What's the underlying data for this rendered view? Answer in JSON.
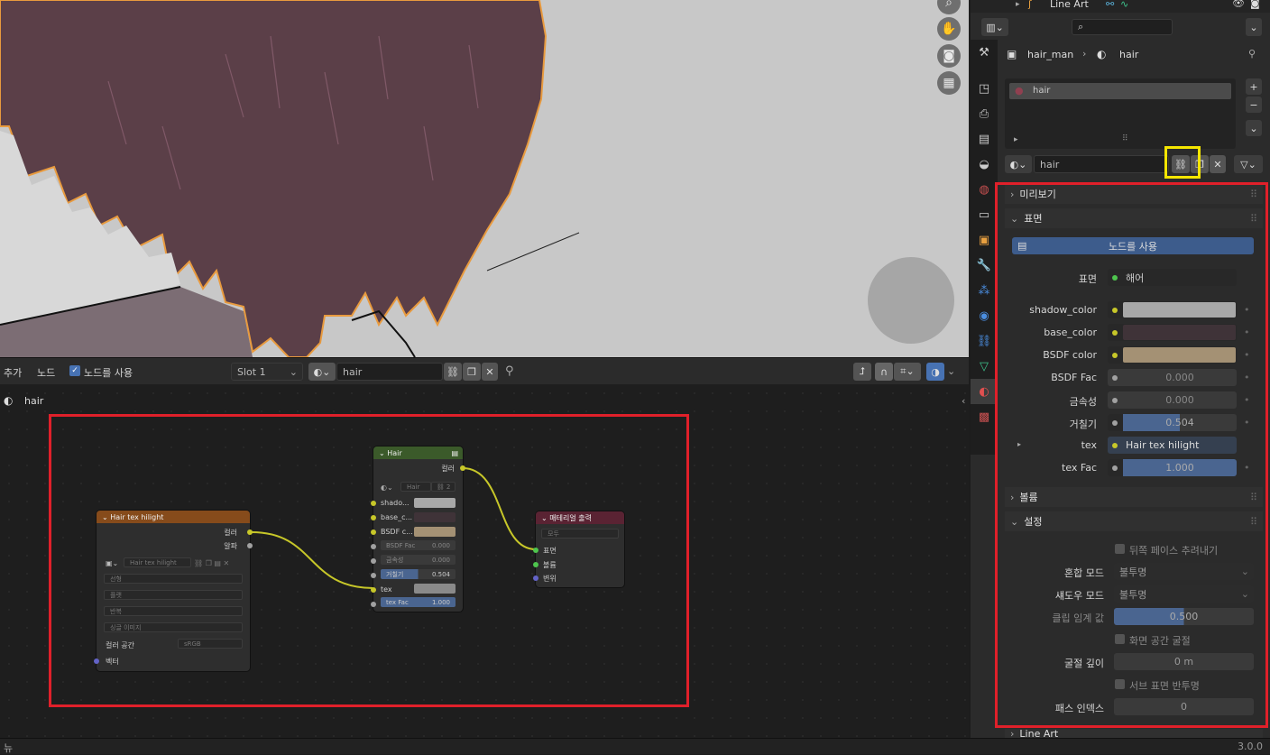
{
  "outliner": {
    "item": "Line Art"
  },
  "properties": {
    "breadcrumb_object": "hair_man",
    "breadcrumb_material": "hair",
    "slot_item": "hair",
    "material_name": "hair",
    "add_label": "+",
    "remove_label": "−",
    "panels": {
      "preview": "미리보기",
      "surface": "표면",
      "volume": "볼륨",
      "settings": "설정",
      "lineart": "Line Art"
    },
    "use_nodes_button": "노드를 사용",
    "surface_label": "표면",
    "surface_value": "해어",
    "inputs": [
      {
        "label": "shadow_color",
        "value": "",
        "color": "#a8a8a8"
      },
      {
        "label": "base_color",
        "value": "",
        "color": "#3f3338"
      },
      {
        "label": "BSDF color",
        "value": "",
        "color": "#a49174"
      },
      {
        "label": "BSDF Fac",
        "value": "0.000"
      },
      {
        "label": "금속성",
        "value": "0.000"
      },
      {
        "label": "거칠기",
        "value": "0.504",
        "fill": 0.504
      },
      {
        "label": "tex",
        "value": "Hair tex hilight"
      },
      {
        "label": "tex Fac",
        "value": "1.000",
        "fill": 1.0
      }
    ],
    "settings": {
      "backface_culling": "뒤쪽 페이스 추려내기",
      "blend_mode_label": "혼합 모드",
      "blend_mode_value": "불투명",
      "shadow_mode_label": "섀도우 모드",
      "shadow_mode_value": "불투명",
      "clip_label": "클립 임계 값",
      "clip_value": "0.500",
      "screen_refraction": "화면 공간 굴절",
      "refraction_depth_label": "굴절 깊이",
      "refraction_depth_value": "0 m",
      "subsurface_translucency": "서브 표면 반투명",
      "pass_index_label": "패스 인덱스",
      "pass_index_value": "0"
    }
  },
  "node_header": {
    "menu_add": "추가",
    "menu_node": "노드",
    "use_nodes": "노드를 사용",
    "slot": "Slot 1",
    "material": "hair",
    "breadcrumb": "hair"
  },
  "nodes": {
    "tex_node": {
      "title": "Hair tex hilight",
      "out_color": "컬러",
      "out_alpha": "알파",
      "image": "Hair tex hilight",
      "interp": "선형",
      "proj": "플랫",
      "ext": "반복",
      "source": "싱글 이미지",
      "colorspace_label": "컬러 공간",
      "colorspace": "sRGB",
      "in_vector": "벡터"
    },
    "group_node": {
      "title": "Hair",
      "out_color": "컬러",
      "group_name": "Hair",
      "users": "2",
      "inputs": [
        {
          "label": "shado...",
          "value": ""
        },
        {
          "label": "base_c...",
          "value": ""
        },
        {
          "label": "BSDF c...",
          "value": ""
        },
        {
          "label": "BSDF Fac",
          "value": "0.000"
        },
        {
          "label": "금속성",
          "value": "0.000"
        },
        {
          "label": "거칠기",
          "value": "0.504"
        },
        {
          "label": "tex",
          "value": ""
        },
        {
          "label": "tex Fac",
          "value": "1.000"
        }
      ]
    },
    "output_node": {
      "title": "매테리얼 출력",
      "target": "모두",
      "inputs": [
        "표면",
        "볼륨",
        "변위"
      ]
    }
  },
  "status": {
    "left": "뉴",
    "version": "3.0.0"
  },
  "colors": {
    "highlight_red": "#e0202a",
    "highlight_yellow": "#f5e600",
    "hair": "#5b3f48"
  }
}
